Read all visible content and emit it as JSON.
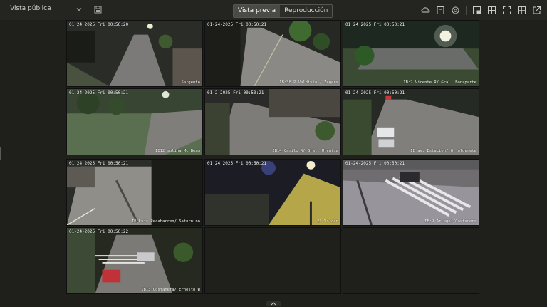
{
  "topbar": {
    "view_title": "Vista pública",
    "tabs": [
      {
        "label": "Vista previa",
        "active": true
      },
      {
        "label": "Reproducción",
        "active": false
      }
    ],
    "tool_icons": [
      "cloud-icon",
      "snapshot-icon",
      "settings-icon",
      "window-icon",
      "layout-icon",
      "fullscreen-icon",
      "grid-icon",
      "export-icon"
    ]
  },
  "cameras": [
    {
      "osd": "01 24 2025 Fri 00:50:20",
      "id": "1326",
      "label": "Sargento"
    },
    {
      "osd": "01-24-2025 Fri 00:50:21",
      "id": "",
      "label": "IB:38 P Valdivia / Zegers"
    },
    {
      "osd": "01 24 2025 Fri 00:50:21",
      "id": "1326",
      "label": "IB:2 Vicente R/ Gral. Bonaparte"
    },
    {
      "osd": "01 24 2025 Fri 00:50:21",
      "id": "1335",
      "label": "IB12 molina Mc Beam"
    },
    {
      "osd": "01 2 2025 Fri 00:50:21",
      "id": "1325",
      "label": "IB14 Camilo R/ Gral. Urrutia"
    },
    {
      "osd": "01 24 2025 Fri 00:50:21",
      "id": "1341",
      "label": "IB av. Estacion/ G. alderete"
    },
    {
      "osd": "01 24 2025 Fri 00:50:21",
      "id": "",
      "label": "IB Luis Recabarren/ Saturnino"
    },
    {
      "osd": "01 24 2025 Fri 00:50:21",
      "id": "",
      "label": "El Volcan"
    },
    {
      "osd": "01-24-2025 Fri 00:50:21",
      "id": "",
      "label": "IB:9 Arlegui/Costanera"
    },
    {
      "osd": "01-24-2025 Fri 00:50:22",
      "id": "",
      "label": "IB13 Costanera/ Ernesto W"
    }
  ]
}
